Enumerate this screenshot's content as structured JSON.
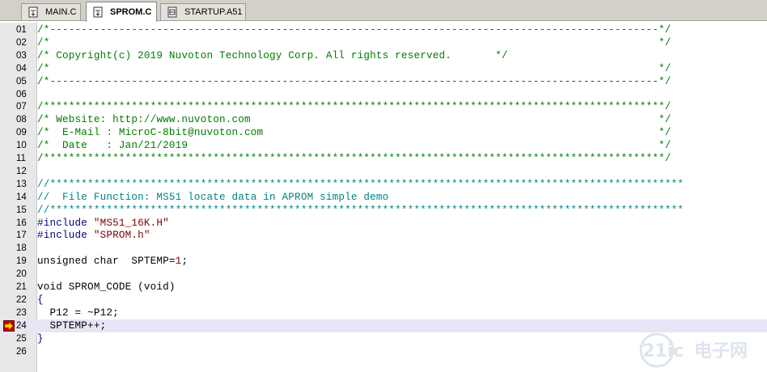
{
  "tabs": [
    {
      "label": "MAIN.C",
      "active": false
    },
    {
      "label": "SPROM.C",
      "active": true
    },
    {
      "label": "STARTUP.A51",
      "active": false
    }
  ],
  "current_line": "24",
  "lines": [
    {
      "n": "01",
      "segs": [
        {
          "t": "/*-------------------------------------------------------------------------------------------------*/",
          "c": "comment"
        }
      ]
    },
    {
      "n": "02",
      "segs": [
        {
          "t": "/*                                                                                                 */",
          "c": "comment"
        }
      ]
    },
    {
      "n": "03",
      "segs": [
        {
          "t": "/* Copyright(c) 2019 Nuvoton Technology Corp. All rights reserved.       */",
          "c": "comment"
        }
      ]
    },
    {
      "n": "04",
      "segs": [
        {
          "t": "/*                                                                                                 */",
          "c": "comment"
        }
      ]
    },
    {
      "n": "05",
      "segs": [
        {
          "t": "/*-------------------------------------------------------------------------------------------------*/",
          "c": "comment"
        }
      ]
    },
    {
      "n": "06",
      "segs": []
    },
    {
      "n": "07",
      "segs": [
        {
          "t": "/***************************************************************************************************/",
          "c": "comment"
        }
      ]
    },
    {
      "n": "08",
      "segs": [
        {
          "t": "/* Website: http://www.nuvoton.com                                                                 */",
          "c": "comment"
        }
      ]
    },
    {
      "n": "09",
      "segs": [
        {
          "t": "/*  E-Mail : MicroC-8bit@nuvoton.com                                                               */",
          "c": "comment"
        }
      ]
    },
    {
      "n": "10",
      "segs": [
        {
          "t": "/*  Date   : Jan/21/2019                                                                           */",
          "c": "comment"
        }
      ]
    },
    {
      "n": "11",
      "segs": [
        {
          "t": "/***************************************************************************************************/",
          "c": "comment"
        }
      ]
    },
    {
      "n": "12",
      "segs": []
    },
    {
      "n": "13",
      "segs": [
        {
          "t": "//*****************************************************************************************************",
          "c": "doc"
        }
      ]
    },
    {
      "n": "14",
      "segs": [
        {
          "t": "//  File Function: MS51 locate data in APROM simple demo",
          "c": "doc"
        }
      ]
    },
    {
      "n": "15",
      "segs": [
        {
          "t": "//*****************************************************************************************************",
          "c": "doc"
        }
      ]
    },
    {
      "n": "16",
      "segs": [
        {
          "t": "#include ",
          "c": "pp"
        },
        {
          "t": "\"MS51_16K.H\"",
          "c": "str"
        }
      ]
    },
    {
      "n": "17",
      "segs": [
        {
          "t": "#include ",
          "c": "pp"
        },
        {
          "t": "\"SPROM.h\"",
          "c": "str"
        }
      ]
    },
    {
      "n": "18",
      "segs": []
    },
    {
      "n": "19",
      "segs": [
        {
          "t": "unsigned char  SPTEMP=",
          "c": "kw"
        },
        {
          "t": "1",
          "c": "num"
        },
        {
          "t": ";",
          "c": "kw"
        }
      ]
    },
    {
      "n": "20",
      "segs": []
    },
    {
      "n": "21",
      "segs": [
        {
          "t": "void SPROM_CODE (void)",
          "c": "kw"
        }
      ]
    },
    {
      "n": "22",
      "segs": [
        {
          "t": "{",
          "c": "pp"
        }
      ]
    },
    {
      "n": "23",
      "segs": [
        {
          "t": "  P12 = ~P12;",
          "c": "kw"
        }
      ]
    },
    {
      "n": "24",
      "segs": [
        {
          "t": "  SPTEMP++;",
          "c": "kw"
        }
      ]
    },
    {
      "n": "25",
      "segs": [
        {
          "t": "}",
          "c": "pp"
        }
      ]
    },
    {
      "n": "26",
      "segs": []
    }
  ],
  "watermark": {
    "brand": "21ic",
    "cn": "电子网"
  },
  "colors": {
    "comment": "#007a00",
    "doc": "#008080",
    "keyword": "#000000",
    "preprocessor": "#000080",
    "string": "#800000",
    "gutter": "#e8e8e8",
    "current_line": "#e6e6f6"
  }
}
